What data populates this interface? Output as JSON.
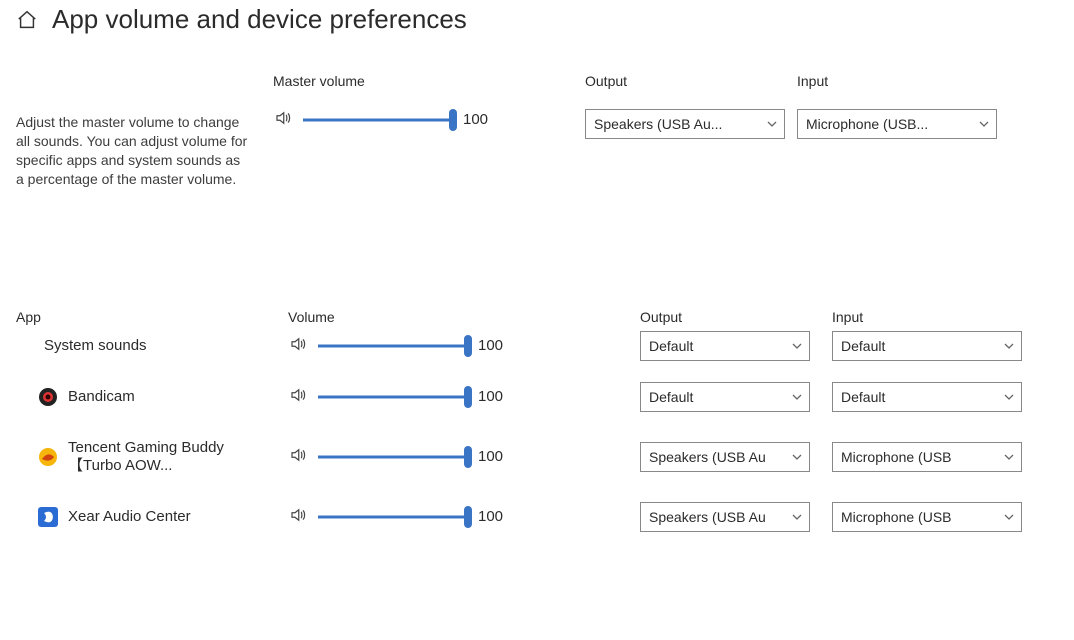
{
  "header": {
    "title": "App volume and device preferences"
  },
  "top": {
    "description": "Adjust the master volume to change all sounds. You can adjust volume for specific apps and system sounds as a percentage of the master volume.",
    "labels": {
      "master": "Master volume",
      "output": "Output",
      "input": "Input"
    },
    "master_value": "100",
    "output_selected": "Speakers (USB Au...",
    "input_selected": "Microphone (USB..."
  },
  "bottom": {
    "labels": {
      "app": "App",
      "volume": "Volume",
      "output": "Output",
      "input": "Input"
    },
    "rows": [
      {
        "name": "System sounds",
        "icon": "none",
        "value": "100",
        "out": "Default",
        "in": "Default"
      },
      {
        "name": "Bandicam",
        "icon": "bandicam",
        "value": "100",
        "out": "Default",
        "in": "Default"
      },
      {
        "name": "Tencent Gaming Buddy【Turbo AOW...",
        "icon": "tencent",
        "value": "100",
        "out": "Speakers (USB Au",
        "in": "Microphone (USB"
      },
      {
        "name": "Xear Audio Center",
        "icon": "xear",
        "value": "100",
        "out": "Speakers (USB Au",
        "in": "Microphone (USB"
      }
    ]
  }
}
